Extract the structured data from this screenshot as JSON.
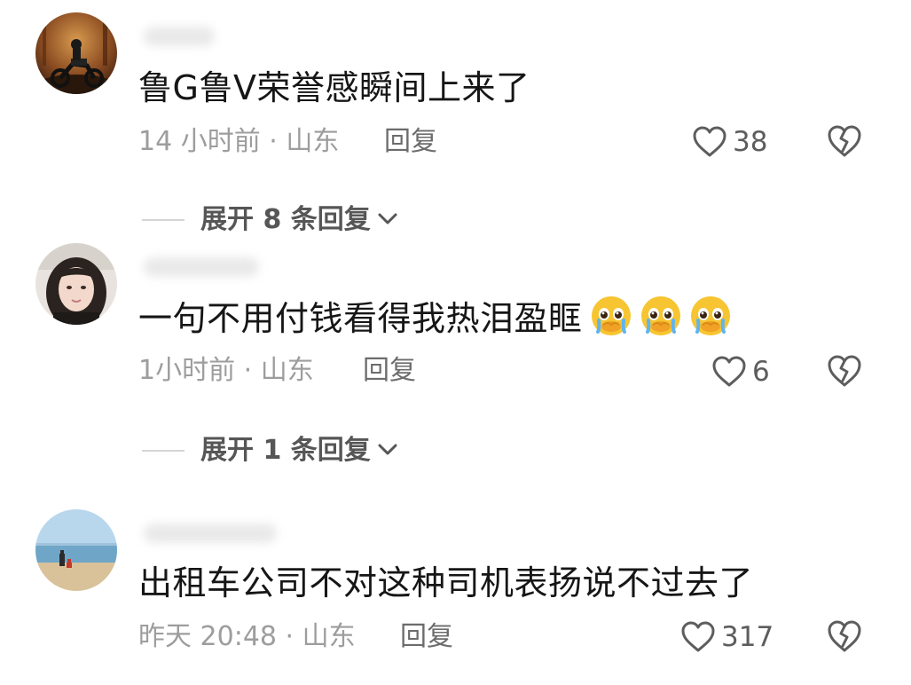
{
  "comments": [
    {
      "text": "鲁G鲁V荣誉感瞬间上来了",
      "meta": "14 小时前 · 山东",
      "reply_label": "回复",
      "likes": "38",
      "emoji_count": 0,
      "expand_label": "展开 8 条回复"
    },
    {
      "text": "一句不用付钱看得我热泪盈眶",
      "meta": "1小时前 · 山东",
      "reply_label": "回复",
      "likes": "6",
      "emoji_count": 3,
      "expand_label": "展开 1 条回复"
    },
    {
      "text": "出租车公司不对这种司机表扬说不过去了",
      "meta": "昨天 20:48 · 山东",
      "reply_label": "回复",
      "likes": "317",
      "emoji_count": 0
    }
  ],
  "icons": {
    "like": "heart-outline-icon",
    "dislike": "broken-heart-icon",
    "expand": "chevron-down-icon",
    "emoji": "pleading-crying-face-emoji"
  },
  "colors": {
    "text": "#161616",
    "meta": "#9d9d9d",
    "icon": "#5d5d5d",
    "emoji": "#f7c531"
  }
}
